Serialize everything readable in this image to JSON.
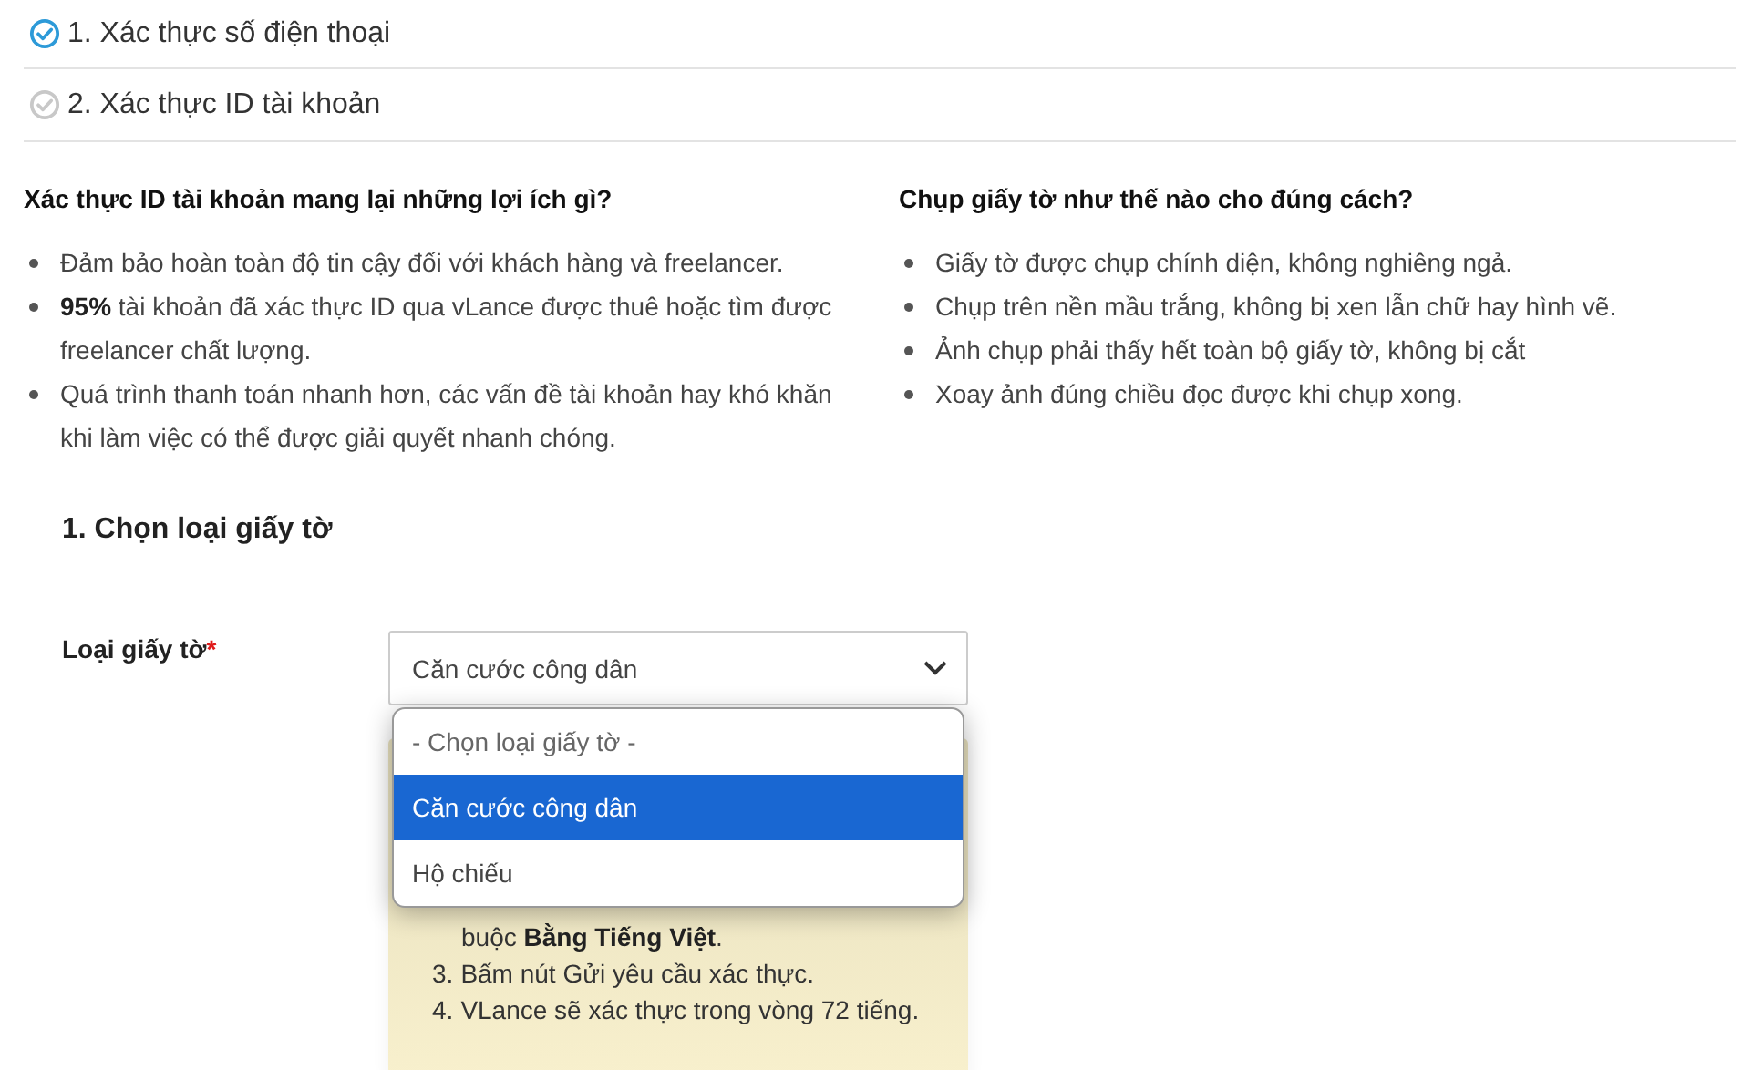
{
  "steps": [
    {
      "label": "1. Xác thực số điện thoại",
      "done": true
    },
    {
      "label": "2. Xác thực ID tài khoản",
      "done": false
    }
  ],
  "info_columns": [
    {
      "title": "Xác thực ID tài khoản mang lại những lợi ích gì?",
      "items": [
        "Đảm bảo hoàn toàn độ tin cậy đối với khách hàng và freelancer.",
        "**95%** tài khoản đã xác thực ID qua vLance được thuê hoặc tìm được freelancer chất lượng.",
        "Quá trình thanh toán nhanh hơn, các vấn đề tài khoản hay khó khăn khi làm việc có thể được giải quyết nhanh chóng."
      ]
    },
    {
      "title": "Chụp giấy tờ như thế nào cho đúng cách?",
      "items": [
        "Giấy tờ được chụp chính diện, không nghiêng ngả.",
        "Chụp trên nền mầu trắng, không bị xen lẫn chữ hay hình vẽ.",
        "Ảnh chụp phải thấy hết toàn bộ giấy tờ, không bị cắt",
        "Xoay ảnh đúng chiều đọc được khi chụp xong."
      ]
    }
  ],
  "section_title": "1. Chọn loại giấy tờ",
  "document_type": {
    "label": "Loại giấy tờ",
    "required_mark": "*",
    "value": "Căn cước công dân",
    "expanded": true,
    "options": [
      {
        "label": "- Chọn loại giấy tờ -",
        "kind": "placeholder",
        "selected": false
      },
      {
        "label": "Căn cước công dân",
        "kind": "option",
        "selected": true
      },
      {
        "label": "Hộ chiếu",
        "kind": "option",
        "selected": false
      }
    ]
  },
  "instructions": [
    {
      "text": "buộc **Bằng Tiếng Việt**."
    },
    {
      "number": "3.",
      "text": "Bấm nút Gửi yêu cầu xác thực."
    },
    {
      "number": "4.",
      "text": "VLance sẽ xác thực trong vòng 72 tiếng."
    }
  ]
}
